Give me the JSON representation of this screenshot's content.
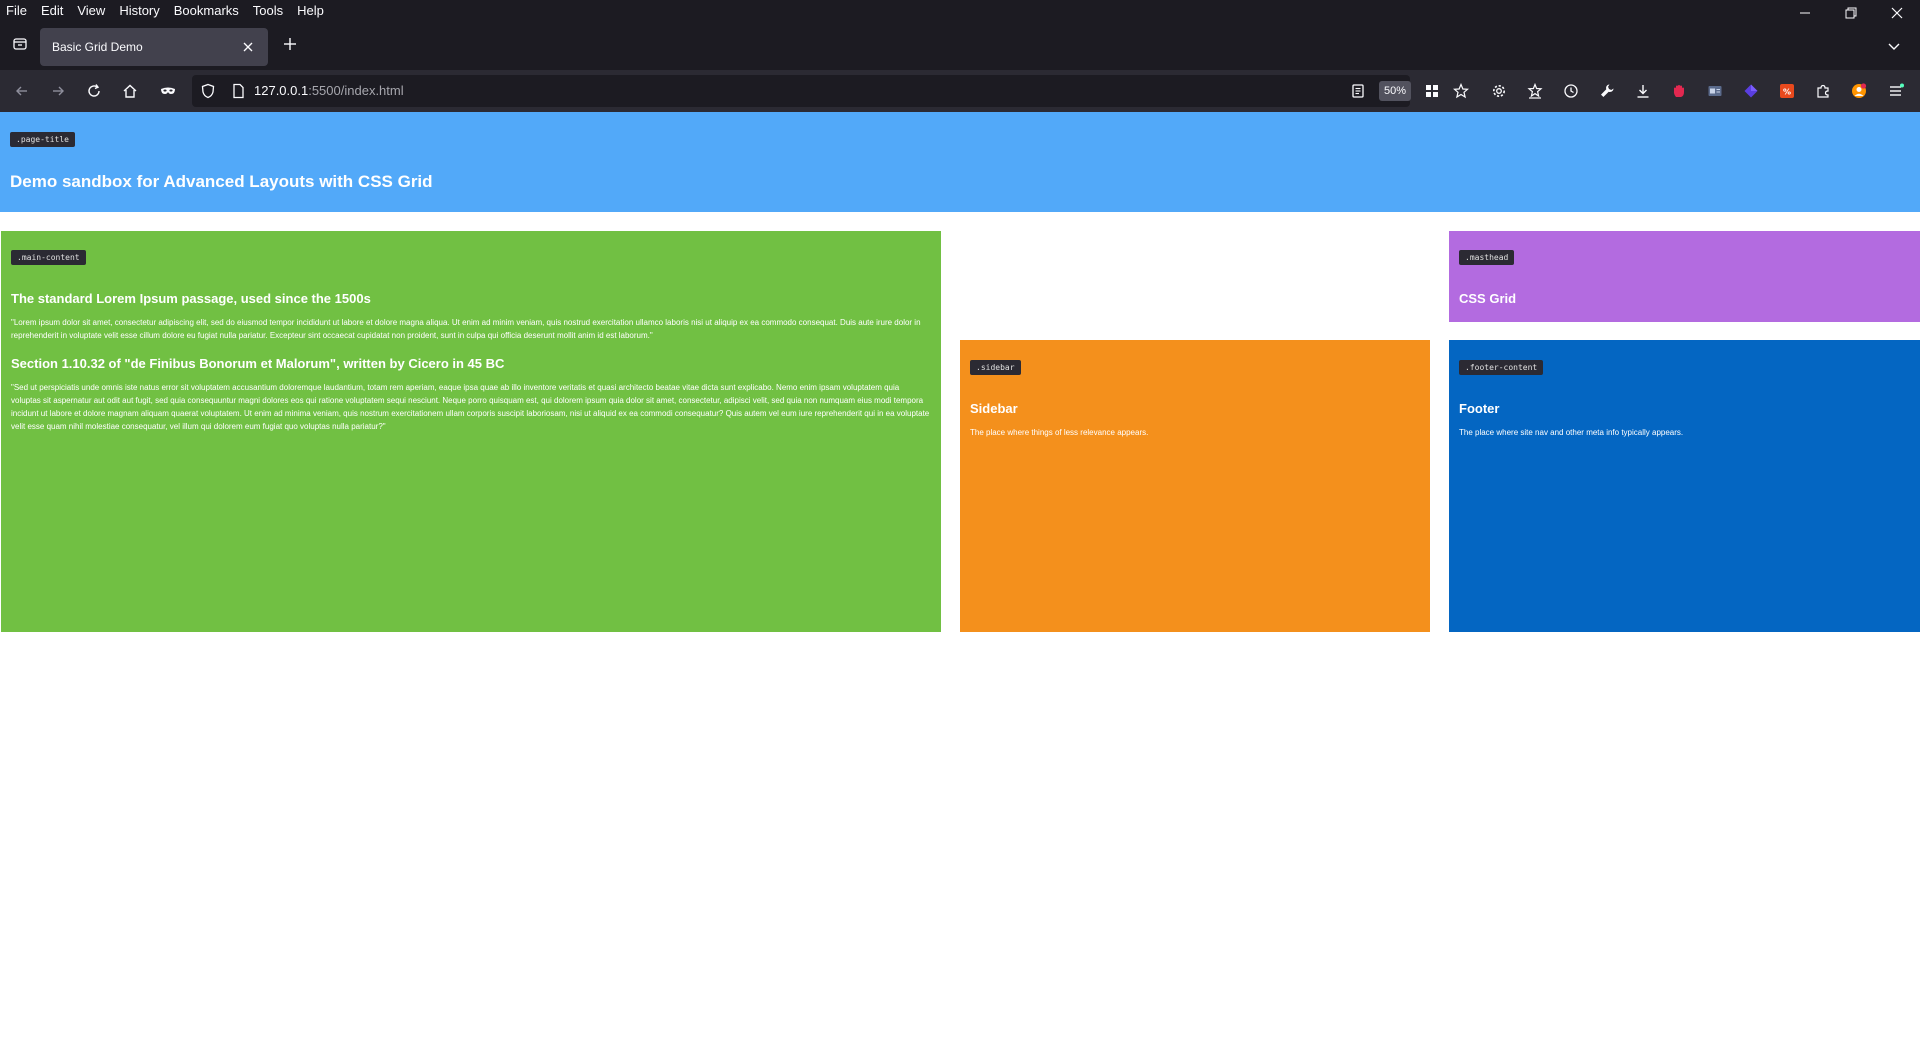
{
  "browser": {
    "menu": [
      "File",
      "Edit",
      "View",
      "History",
      "Bookmarks",
      "Tools",
      "Help"
    ],
    "tab_title": "Basic Grid Demo",
    "url_host": "127.0.0.1",
    "url_rest": ":5500/index.html",
    "zoom": "50%",
    "icons": {
      "back": "arrow-left-icon",
      "forward": "arrow-right-icon",
      "reload": "reload-icon",
      "home": "home-icon",
      "extensions": "extensions-icon",
      "downloads": "download-icon"
    }
  },
  "page": {
    "page_title": {
      "tag": ".page-title",
      "heading": "Demo sandbox for Advanced Layouts with CSS Grid"
    },
    "main_content": {
      "tag": ".main-content",
      "heading1": "The standard Lorem Ipsum passage, used since the 1500s",
      "para1": "\"Lorem ipsum dolor sit amet, consectetur adipiscing elit, sed do eiusmod tempor incididunt ut labore et dolore magna aliqua. Ut enim ad minim veniam, quis nostrud exercitation ullamco laboris nisi ut aliquip ex ea commodo consequat. Duis aute irure dolor in reprehenderit in voluptate velit esse cillum dolore eu fugiat nulla pariatur. Excepteur sint occaecat cupidatat non proident, sunt in culpa qui officia deserunt mollit anim id est laborum.\"",
      "heading2": "Section 1.10.32 of \"de Finibus Bonorum et Malorum\", written by Cicero in 45 BC",
      "para2": "\"Sed ut perspiciatis unde omnis iste natus error sit voluptatem accusantium doloremque laudantium, totam rem aperiam, eaque ipsa quae ab illo inventore veritatis et quasi architecto beatae vitae dicta sunt explicabo. Nemo enim ipsam voluptatem quia voluptas sit aspernatur aut odit aut fugit, sed quia consequuntur magni dolores eos qui ratione voluptatem sequi nesciunt. Neque porro quisquam est, qui dolorem ipsum quia dolor sit amet, consectetur, adipisci velit, sed quia non numquam eius modi tempora incidunt ut labore et dolore magnam aliquam quaerat voluptatem. Ut enim ad minima veniam, quis nostrum exercitationem ullam corporis suscipit laboriosam, nisi ut aliquid ex ea commodi consequatur? Quis autem vel eum iure reprehenderit qui in ea voluptate velit esse quam nihil molestiae consequatur, vel illum qui dolorem eum fugiat quo voluptas nulla pariatur?\""
    },
    "masthead": {
      "tag": ".masthead",
      "heading": "CSS Grid"
    },
    "sidebar": {
      "tag": ".sidebar",
      "heading": "Sidebar",
      "text": "The place where things of less relevance appears."
    },
    "footer": {
      "tag": ".footer-content",
      "heading": "Footer",
      "text": "The place where site nav and other meta info typically appears."
    },
    "colors": {
      "page_title": "#52a9f9",
      "main_content": "#71c043",
      "masthead": "#b36be0",
      "sidebar": "#f4901c",
      "footer": "#0466c2"
    }
  }
}
